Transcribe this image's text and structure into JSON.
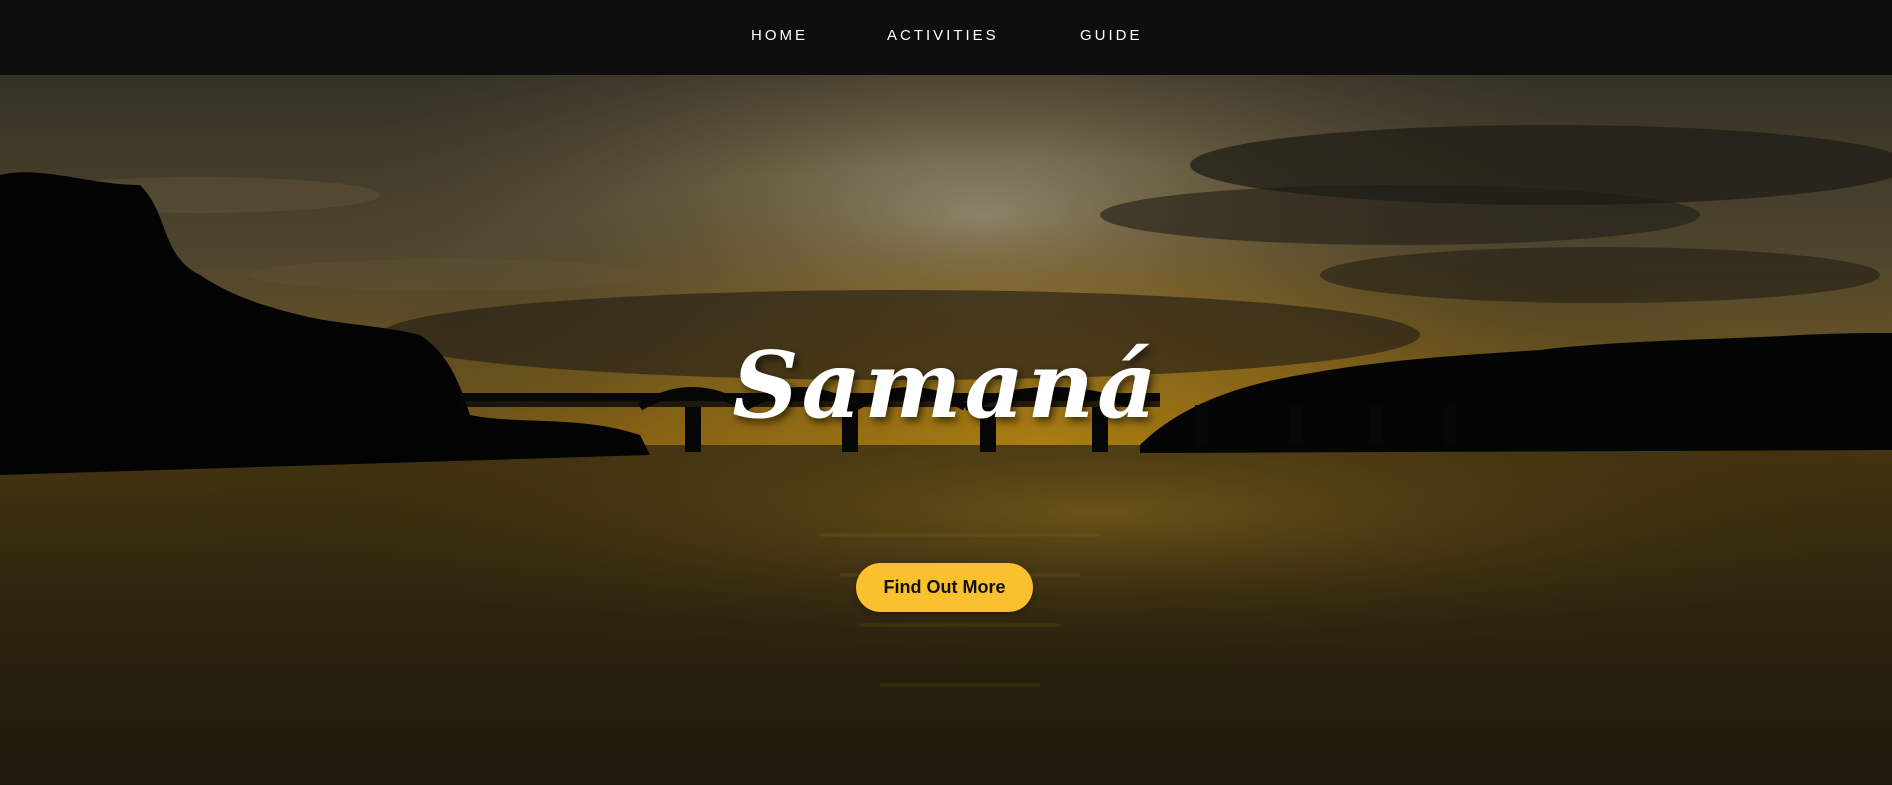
{
  "nav": {
    "items": [
      {
        "label": "HOME"
      },
      {
        "label": "ACTIVITIES"
      },
      {
        "label": "GUIDE"
      }
    ]
  },
  "hero": {
    "title": "Samaná",
    "button_label": "Find Out More",
    "background": "sunset-bridge-over-bay"
  },
  "colors": {
    "navbar": "#0e0e0e",
    "nav_text": "#ffffff",
    "accent": "#fbc02d",
    "title": "#ffffff"
  }
}
